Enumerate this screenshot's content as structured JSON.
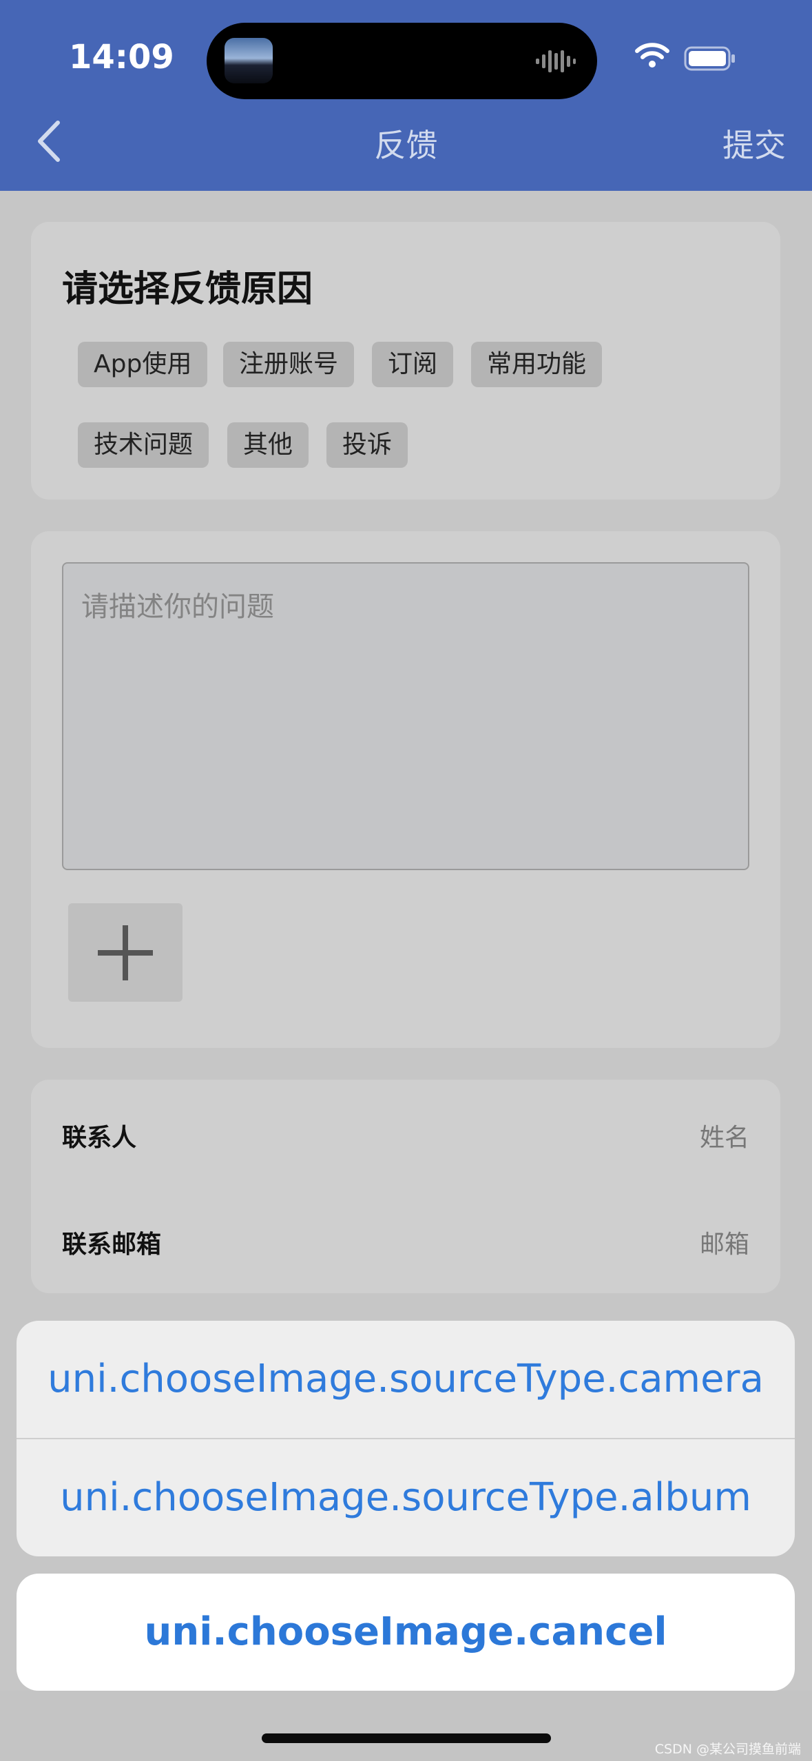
{
  "status": {
    "time": "14:09"
  },
  "navbar": {
    "title": "反馈",
    "submit": "提交"
  },
  "reasons": {
    "title": "请选择反馈原因",
    "tags": [
      "App使用",
      "注册账号",
      "订阅",
      "常用功能",
      "技术问题",
      "其他",
      "投诉"
    ]
  },
  "description": {
    "placeholder": "请描述你的问题"
  },
  "contact": {
    "name_label": "联系人",
    "name_placeholder": "姓名",
    "email_label": "联系邮箱",
    "email_placeholder": "邮箱"
  },
  "action_sheet": {
    "options": [
      "uni.chooseImage.sourceType.camera",
      "uni.chooseImage.sourceType.album"
    ],
    "cancel": "uni.chooseImage.cancel"
  },
  "watermark": "CSDN @某公司摸鱼前端",
  "colors": {
    "header": "#4666b6",
    "action_text": "#2f7bdc"
  }
}
